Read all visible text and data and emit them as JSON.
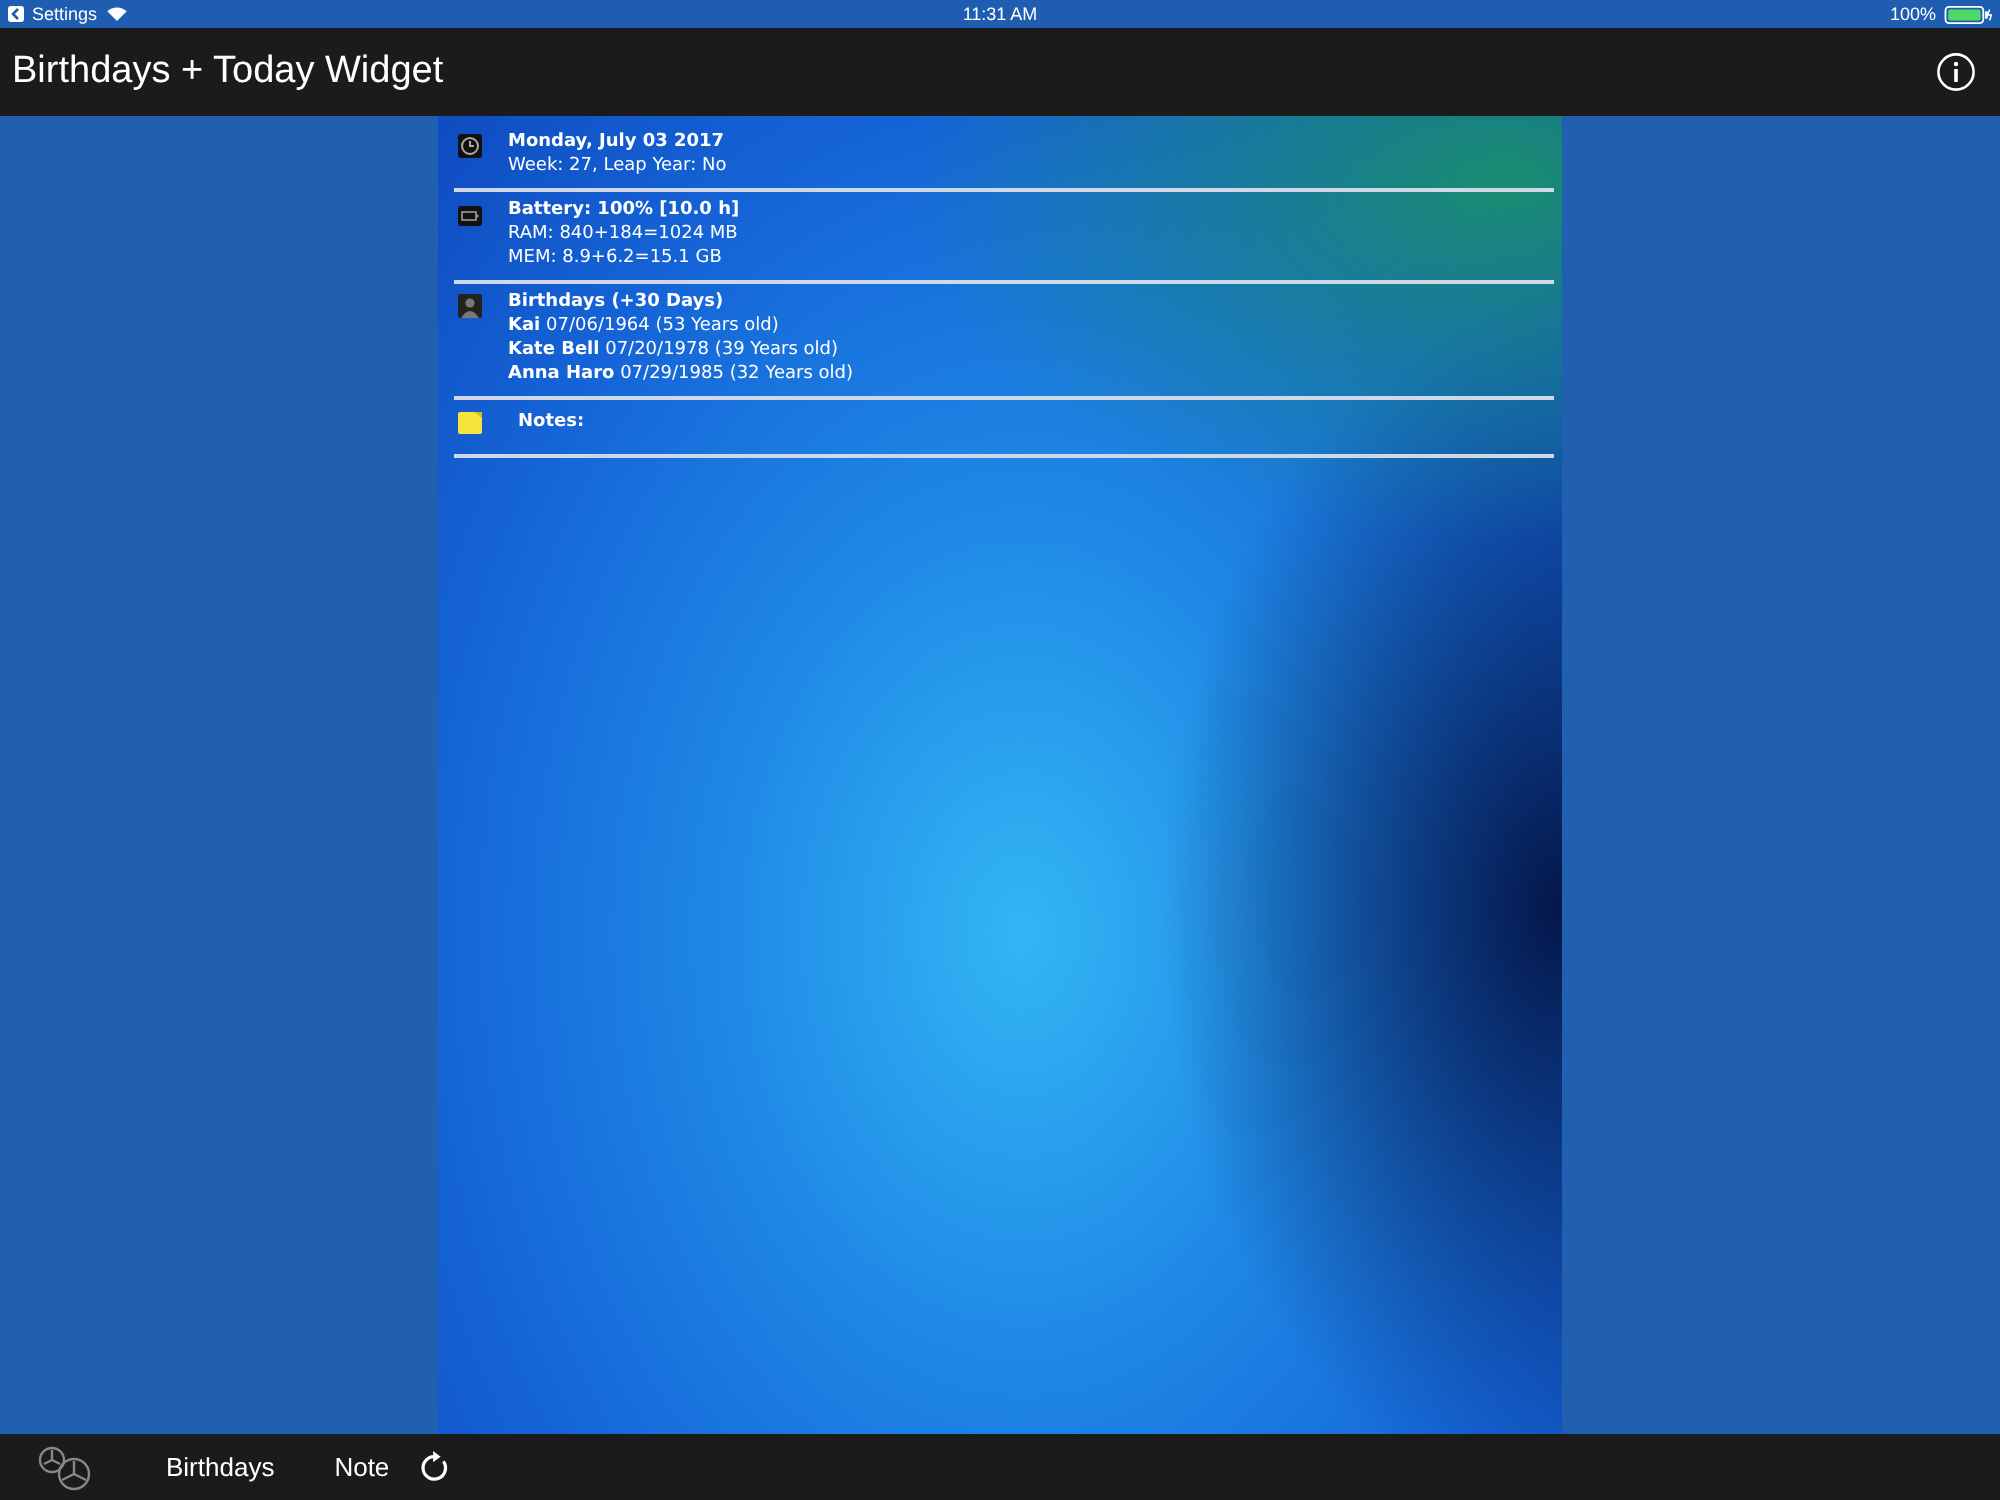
{
  "status_bar": {
    "back_label": "Settings",
    "time": "11:31 AM",
    "battery": "100%"
  },
  "nav_bar": {
    "title": "Birthdays + Today Widget"
  },
  "sections": [
    {
      "kind": "clock",
      "title": "Monday, July 03 2017",
      "lines": [
        "Week: 27, Leap Year: No"
      ]
    },
    {
      "kind": "battery",
      "title": "Battery: 100% [10.0 h]",
      "lines": [
        "RAM: 840+184=1024 MB",
        "MEM: 8.9+6.2=15.1 GB"
      ]
    },
    {
      "kind": "person",
      "title": "Birthdays (+30 Days)",
      "lines": [
        "**Kai** 07/06/1964 (53 Years old)",
        "**Kate Bell** 07/20/1978 (39 Years old)",
        "**Anna Haro** 07/29/1985 (32 Years old)"
      ]
    },
    {
      "kind": "note",
      "title": "Notes:"
    }
  ],
  "tab_bar": {
    "items": [
      "Birthdays",
      "Note"
    ]
  }
}
